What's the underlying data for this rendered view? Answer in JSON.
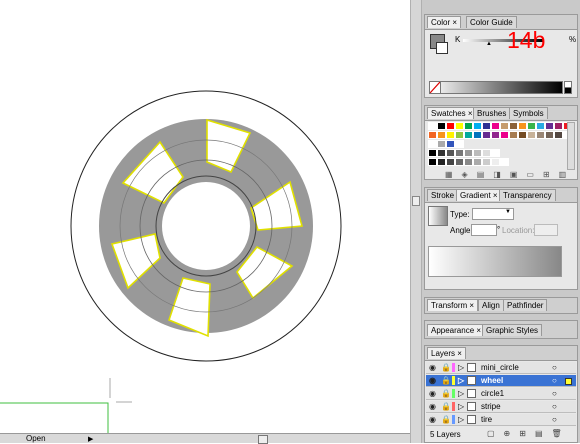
{
  "annotation": "14b",
  "bottom": {
    "status": "Open"
  },
  "color_panel": {
    "tabs": [
      "Color",
      "Color Guide"
    ],
    "channel": "K",
    "unit": "%"
  },
  "swatches_panel": {
    "tabs": [
      "Swatches",
      "Brushes",
      "Symbols"
    ]
  },
  "gradient_panel": {
    "tabs": [
      "Stroke",
      "Gradient",
      "Transparency"
    ],
    "type_label": "Type:",
    "angle_label": "Angle:",
    "location_label": "Location:",
    "degree": "°"
  },
  "transform_panel": {
    "tabs": [
      "Transform",
      "Align",
      "Pathfinder"
    ]
  },
  "appearance_panel": {
    "tabs": [
      "Appearance",
      "Graphic Styles"
    ]
  },
  "layers_panel": {
    "tab": "Layers",
    "layers": [
      {
        "name": "mini_circle",
        "color": "#ff66ff",
        "selected": false
      },
      {
        "name": "wheel",
        "color": "#ffff33",
        "selected": true
      },
      {
        "name": "circle1",
        "color": "#66ff66",
        "selected": false
      },
      {
        "name": "stripe",
        "color": "#ff6666",
        "selected": false
      },
      {
        "name": "tire",
        "color": "#6699ff",
        "selected": false
      }
    ],
    "footer": "5 Layers"
  },
  "colors": {
    "wheel_fill": "#999999",
    "selection": "#ffff00",
    "active_layer": "#3a73d4",
    "annotation": "#ff0000"
  }
}
